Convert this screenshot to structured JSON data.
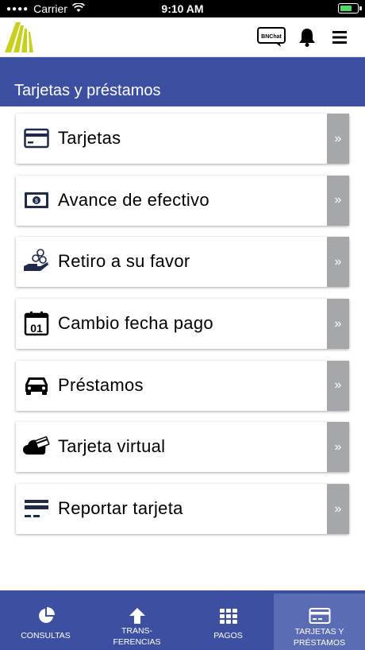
{
  "status_bar": {
    "carrier": "Carrier",
    "time": "9:10 AM"
  },
  "header": {
    "chat_label": "BNChat"
  },
  "section": {
    "title": "Tarjetas y préstamos"
  },
  "menu": {
    "items": [
      {
        "label": "Tarjetas",
        "icon": "credit-card-icon"
      },
      {
        "label": "Avance de efectivo",
        "icon": "cash-icon"
      },
      {
        "label": "Retiro a su favor",
        "icon": "hand-coins-icon"
      },
      {
        "label": "Cambio fecha pago",
        "icon": "calendar-icon"
      },
      {
        "label": "Préstamos",
        "icon": "car-icon"
      },
      {
        "label": "Tarjeta virtual",
        "icon": "cloud-card-icon"
      },
      {
        "label": "Reportar tarjeta",
        "icon": "report-card-icon"
      }
    ],
    "chevron": "»"
  },
  "bottom_nav": {
    "tabs": [
      {
        "label": "CONSULTAS",
        "icon": "pie-chart-icon"
      },
      {
        "label": "TRANS-\nFERENCIAS",
        "icon": "arrow-up-icon"
      },
      {
        "label": "PAGOS",
        "icon": "grid-icon"
      },
      {
        "label": "TARJETAS Y\nPRÉSTAMOS",
        "icon": "card-icon"
      }
    ],
    "active_index": 3
  },
  "colors": {
    "primary": "#3c4fa0",
    "active_tab": "#5a6cb4",
    "chevron_box": "#a5a7aa",
    "logo": "#c8cf1e",
    "battery": "#4cd964"
  }
}
